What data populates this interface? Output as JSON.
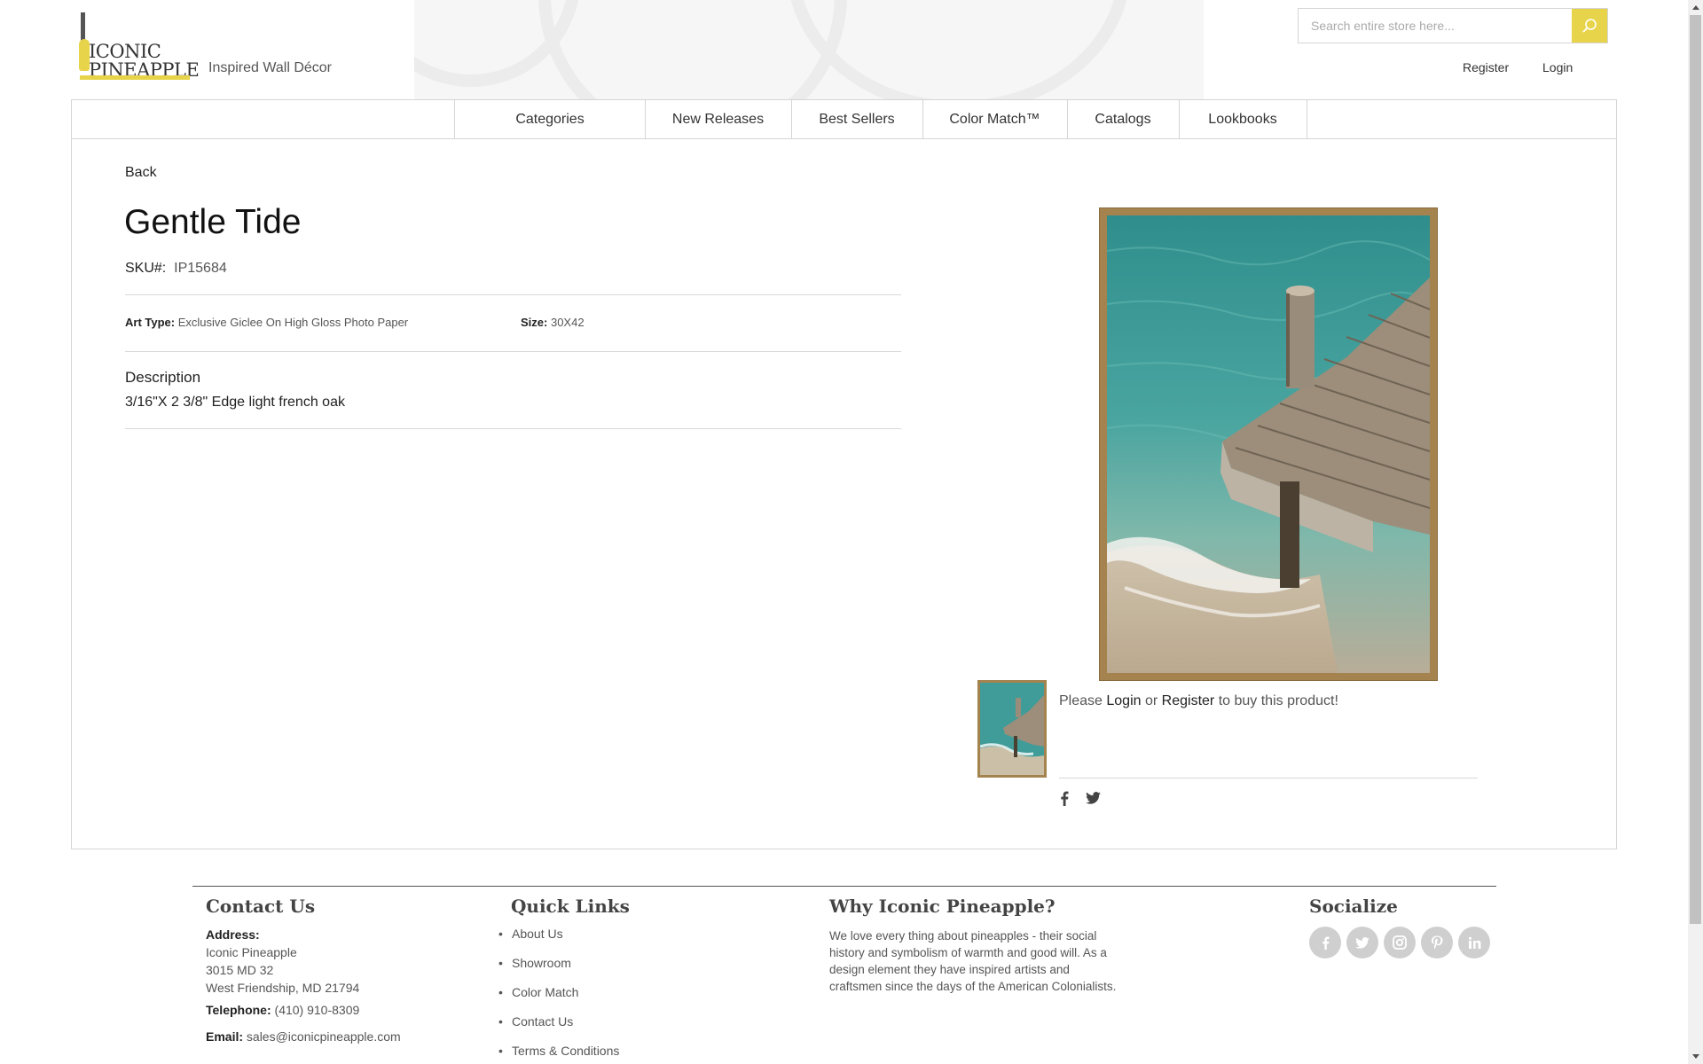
{
  "header": {
    "logo_line1": "ICONIC",
    "logo_line2": "PINEAPPLE",
    "tagline": "Inspired Wall Décor",
    "search_placeholder": "Search entire store here...",
    "register_label": "Register",
    "login_label": "Login"
  },
  "nav": {
    "items": [
      {
        "label": "Categories"
      },
      {
        "label": "New Releases"
      },
      {
        "label": "Best Sellers"
      },
      {
        "label": "Color Match™"
      },
      {
        "label": "Catalogs"
      },
      {
        "label": "Lookbooks"
      }
    ]
  },
  "product": {
    "back_label": "Back",
    "title": "Gentle Tide",
    "sku_label": "SKU#:",
    "sku": "IP15684",
    "art_type_label": "Art Type:",
    "art_type": "Exclusive Giclee On High Gloss Photo Paper",
    "size_label": "Size:",
    "size": "30X42",
    "description_heading": "Description",
    "description": "3/16\"X 2 3/8\" Edge light french oak",
    "buy_prefix": "Please",
    "buy_login": "Login",
    "buy_or": "or",
    "buy_register": "Register",
    "buy_suffix": "to buy this product!"
  },
  "footer": {
    "contact": {
      "heading": "Contact Us",
      "address_label": "Address:",
      "address_lines": [
        "Iconic Pineapple",
        "3015 MD 32",
        "West Friendship, MD 21794"
      ],
      "telephone_label": "Telephone:",
      "telephone": "(410) 910-8309",
      "email_label": "Email:",
      "email": "sales@iconicpineapple.com"
    },
    "quick_links": {
      "heading": "Quick Links",
      "items": [
        "About Us",
        "Showroom",
        "Color Match",
        "Contact Us",
        "Terms & Conditions"
      ]
    },
    "why": {
      "heading": "Why Iconic Pineapple?",
      "text": "We love every thing about pineapples - their social history and symbolism of warmth and good will. As a design element they have inspired artists and craftsmen since the days of the American Colonialists."
    },
    "socialize": {
      "heading": "Socialize",
      "icons": [
        "facebook-icon",
        "twitter-icon",
        "instagram-icon",
        "pinterest-icon",
        "linkedin-icon"
      ]
    }
  },
  "colors": {
    "accent_yellow": "#e8d44a",
    "frame_oak": "#a4834f",
    "border_gray": "#d5d5d5"
  }
}
